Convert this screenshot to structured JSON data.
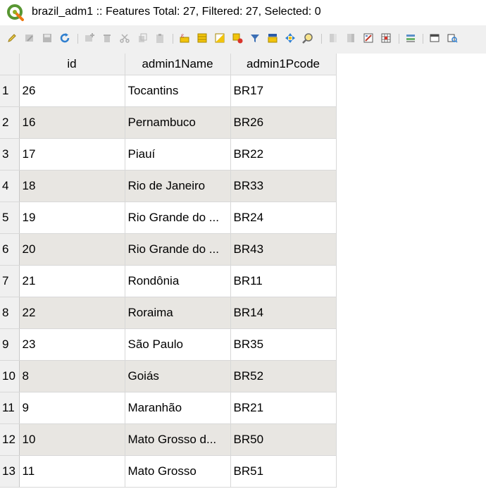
{
  "window": {
    "title": "brazil_adm1 :: Features Total: 27, Filtered: 27, Selected: 0"
  },
  "toolbar": {
    "buttons": [
      {
        "name": "toggle-editing",
        "icon": "pencil-icon"
      },
      {
        "name": "toggle-multi-edit",
        "icon": "multi-edit-icon"
      },
      {
        "name": "save-edits",
        "icon": "save-icon"
      },
      {
        "name": "reload-table",
        "icon": "reload-icon"
      },
      {
        "name": "add-feature",
        "icon": "add-feature-icon"
      },
      {
        "name": "delete-selected",
        "icon": "trash-icon"
      },
      {
        "name": "cut-features",
        "icon": "scissors-icon"
      },
      {
        "name": "copy-features",
        "icon": "copy-icon"
      },
      {
        "name": "paste-features",
        "icon": "paste-icon"
      },
      {
        "name": "select-by-expression",
        "icon": "expression-icon"
      },
      {
        "name": "select-all",
        "icon": "select-all-icon"
      },
      {
        "name": "invert-selection",
        "icon": "invert-selection-icon"
      },
      {
        "name": "deselect-all",
        "icon": "deselect-icon"
      },
      {
        "name": "filter-select-form",
        "icon": "filter-icon"
      },
      {
        "name": "move-selection-top",
        "icon": "move-top-icon"
      },
      {
        "name": "pan-to-selected",
        "icon": "pan-icon"
      },
      {
        "name": "zoom-to-selected",
        "icon": "zoom-icon"
      },
      {
        "name": "new-field",
        "icon": "new-field-icon"
      },
      {
        "name": "delete-field",
        "icon": "delete-field-icon"
      },
      {
        "name": "field-calculator",
        "icon": "field-calc-icon"
      },
      {
        "name": "conditional-formatting",
        "icon": "conditional-format-icon"
      },
      {
        "name": "organize-columns",
        "icon": "columns-icon"
      },
      {
        "name": "dock-table",
        "icon": "dock-icon"
      },
      {
        "name": "actions",
        "icon": "actions-icon"
      }
    ]
  },
  "table": {
    "columns": [
      "id",
      "admin1Name",
      "admin1Pcode"
    ],
    "rows": [
      {
        "n": "1",
        "id": "26",
        "name": "Tocantins",
        "pcode": "BR17"
      },
      {
        "n": "2",
        "id": "16",
        "name": "Pernambuco",
        "pcode": "BR26"
      },
      {
        "n": "3",
        "id": "17",
        "name": "Piauí",
        "pcode": "BR22"
      },
      {
        "n": "4",
        "id": "18",
        "name": "Rio de Janeiro",
        "pcode": "BR33"
      },
      {
        "n": "5",
        "id": "19",
        "name": "Rio Grande do ...",
        "pcode": "BR24"
      },
      {
        "n": "6",
        "id": "20",
        "name": "Rio Grande do ...",
        "pcode": "BR43"
      },
      {
        "n": "7",
        "id": "21",
        "name": "Rondônia",
        "pcode": "BR11"
      },
      {
        "n": "8",
        "id": "22",
        "name": "Roraima",
        "pcode": "BR14"
      },
      {
        "n": "9",
        "id": "23",
        "name": "São Paulo",
        "pcode": "BR35"
      },
      {
        "n": "10",
        "id": "8",
        "name": "Goiás",
        "pcode": "BR52"
      },
      {
        "n": "11",
        "id": "9",
        "name": "Maranhão",
        "pcode": "BR21"
      },
      {
        "n": "12",
        "id": "10",
        "name": "Mato Grosso d...",
        "pcode": "BR50"
      },
      {
        "n": "13",
        "id": "11",
        "name": "Mato Grosso",
        "pcode": "BR51"
      }
    ]
  }
}
